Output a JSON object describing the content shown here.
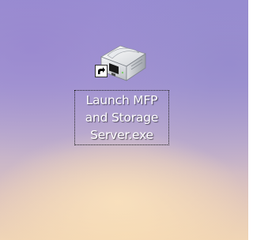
{
  "desktop": {
    "icons": [
      {
        "icon": "printer-server-icon",
        "overlay": "shortcut-arrow-icon",
        "label_lines": [
          "Launch MFP",
          "and Storage",
          "Server.exe"
        ]
      }
    ]
  },
  "colors": {
    "wallpaper_top": "#9a8fd3",
    "wallpaper_bottom": "#eed4b8",
    "label_text": "#ffffff"
  }
}
